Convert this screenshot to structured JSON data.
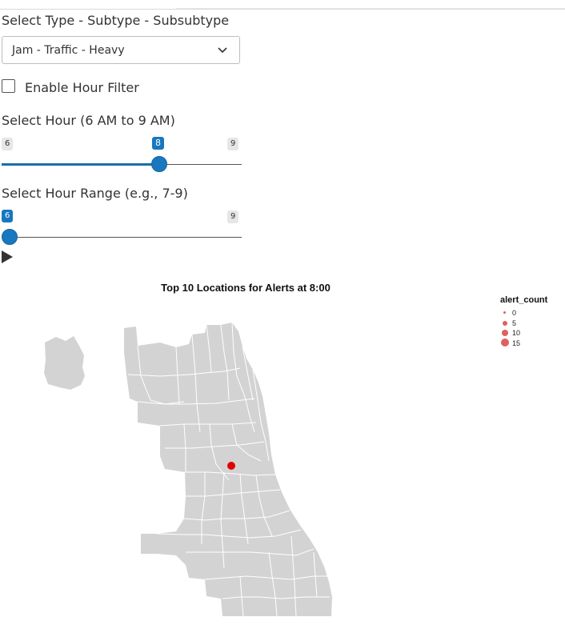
{
  "controls": {
    "type_select": {
      "label": "Select Type - Subtype - Subsubtype",
      "value": "Jam - Traffic - Heavy"
    },
    "hour_filter": {
      "label": "Enable Hour Filter",
      "checked": false
    },
    "hour_slider": {
      "label": "Select Hour (6 AM to 9 AM)",
      "min_label": "6",
      "max_label": "9",
      "value_label": "8",
      "value": 8
    },
    "hour_range_slider": {
      "label": "Select Hour Range (e.g., 7-9)",
      "min_label": "6",
      "max_label": "9",
      "value_label": "6",
      "value": 6
    }
  },
  "chart": {
    "title": "Top 10 Locations for Alerts at 8:00",
    "legend": {
      "title": "alert_count",
      "items": [
        "0",
        "5",
        "10",
        "15"
      ]
    },
    "colors": {
      "map_fill": "#d3d3d3",
      "map_stroke": "#ffffff",
      "point": "#e30000",
      "legend_point": "#e06060",
      "accent": "#1778bf"
    }
  }
}
